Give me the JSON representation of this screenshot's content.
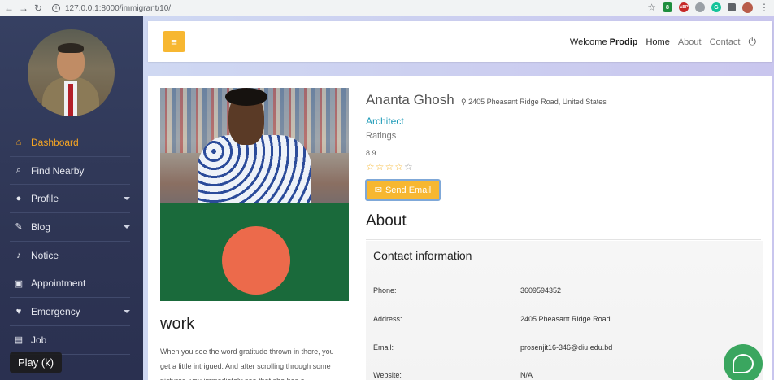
{
  "browser": {
    "url": "127.0.0.1:8000/immigrant/10/",
    "back_icon": "←",
    "forward_icon": "→",
    "reload_icon": "↻",
    "star_icon": "☆",
    "ext_badge": "8",
    "ext_abp": "ABP",
    "ext_g": "G",
    "menu_icon": "⋮"
  },
  "sidebar": {
    "items": [
      {
        "label": "Dashboard",
        "icon": "⌂"
      },
      {
        "label": "Find Nearby",
        "icon": "⌕"
      },
      {
        "label": "Profile",
        "icon": "●"
      },
      {
        "label": "Blog",
        "icon": "✎"
      },
      {
        "label": "Notice",
        "icon": "♪"
      },
      {
        "label": "Appointment",
        "icon": "▣"
      },
      {
        "label": "Emergency",
        "icon": "♥"
      },
      {
        "label": "Job",
        "icon": "▤"
      }
    ]
  },
  "tooltip": "Play (k)",
  "header": {
    "burger_icon": "≡",
    "welcome": "Welcome",
    "user": "Prodip",
    "home": "Home",
    "about": "About",
    "contact": "Contact",
    "power_icon": "⏻"
  },
  "profile": {
    "name": "Ananta Ghosh",
    "location_icon": "⚲",
    "location": "2405 Pheasant Ridge Road, United States",
    "profession": "Architect",
    "ratings_label": "Ratings",
    "score": "8.9",
    "stars_on": "☆☆☆☆",
    "stars_off": "☆",
    "send_icon": "✉",
    "send_label": "Send Email",
    "about_title": "About",
    "work_title": "work",
    "work_text": "When you see the word gratitude thrown in there, you get a little intrigued. And after scrolling through some pictures, you immediately see that she has a"
  },
  "contact": {
    "title": "Contact information",
    "rows": [
      {
        "label": "Phone:",
        "value": "3609594352"
      },
      {
        "label": "Address:",
        "value": "2405 Pheasant Ridge Road"
      },
      {
        "label": "Email:",
        "value": "prosenjit16-346@diu.edu.bd"
      },
      {
        "label": "Website:",
        "value": "N/A"
      }
    ]
  },
  "colors": {
    "accent": "#f7b731",
    "sidebar": "#2e3554",
    "link": "#1e9bb8"
  }
}
